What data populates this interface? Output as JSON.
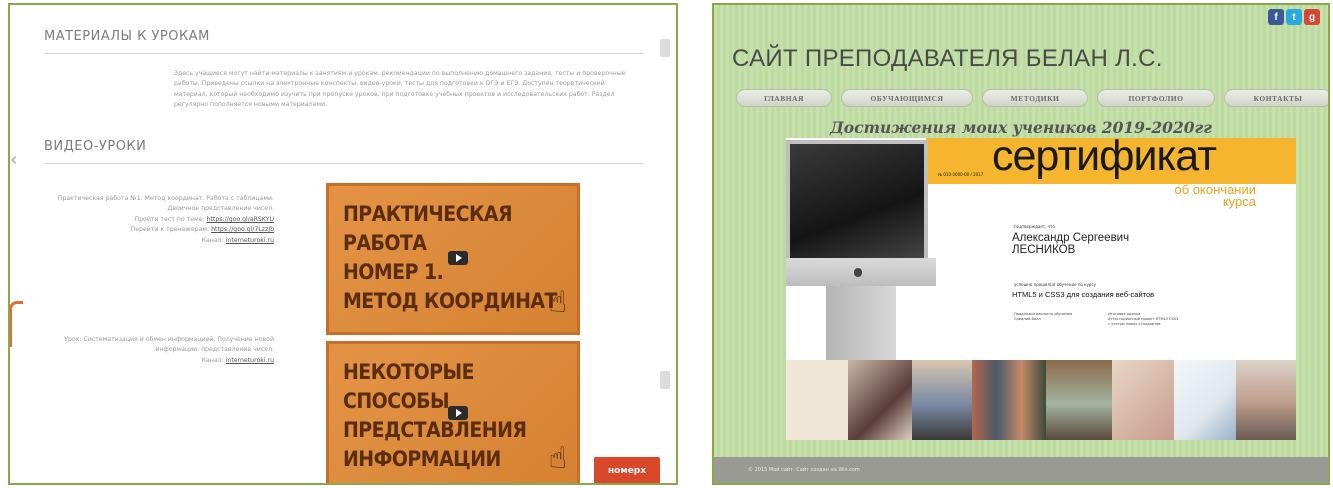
{
  "left": {
    "materials_title": "МАТЕРИАЛЫ К УРОКАМ",
    "materials_text": "Здесь учащиеся могут найти материалы к занятиям и урокам, рекомендации по выполнению домашнего задания, тесты и проверочные работы. Приведены ссылки на электронные конспекты, видео-уроки, тесты для подготовки к ОГЭ и ЕГЭ. Доступен теоретический материал, который необходимо изучить при пропуске уроков, при подготовке учебных проектов и исследовательских работ. Раздел регулярно пополняется новыми материалами.",
    "video_title": "ВИДЕО-УРОКИ",
    "videos": [
      {
        "desc": "Практическая работа №1. Метод координат. Работа с таблицами. Двоичное представление чисел.",
        "link1_label": "Пройти тест по теме:",
        "link1": "https://goo.gl/aRSKYU",
        "link2_label": "Перейти к тренажерам:",
        "link2": "https://goo.gl/7LzzJb",
        "link3_label": "Канал:",
        "link3": "interneturoki.ru",
        "title": "ПРАКТИЧЕСКАЯ РАБОТА\nНОМЕР 1.\nМЕТОД КООРДИНАТ"
      },
      {
        "desc": "Урок: Систематизация и обмен информацией. Получение новой информации, представление чисел.",
        "link3_label": "Канал:",
        "link3": "interneturoki.ru",
        "title": "НЕКОТОРЫЕ СПОСОБЫ\nПРЕДСТАВЛЕНИЯ\nИНФОРМАЦИИ"
      }
    ],
    "hand_glyph": "☝",
    "button_label": "номерх",
    "colors": {
      "video_bg": "#e28a35",
      "button": "#d9482a",
      "frame": "#8aa84a"
    }
  },
  "right": {
    "social": [
      {
        "icon": "facebook-icon",
        "glyph": "f",
        "color": "#3b5998"
      },
      {
        "icon": "twitter-icon",
        "glyph": "t",
        "color": "#2aa9e0"
      },
      {
        "icon": "googleplus-icon",
        "glyph": "g",
        "color": "#d34836"
      }
    ],
    "site_title": "САЙТ ПРЕПОДАВАТЕЛЯ БЕЛАН Л.С.",
    "nav": [
      "ГЛАВНАЯ",
      "ОБУЧАЮЩИМСЯ",
      "МЕТОДИКИ",
      "ПОРТФОЛИО",
      "КОНТАКТЫ"
    ],
    "achievements_title": "Достижения моих учеников 2019-2020гг",
    "certificate": {
      "word": "сертификат",
      "subtitle": "об окончании\nкурса",
      "date": "№ 010-0000-00 / 2017",
      "certify_label": "подтверждает, что",
      "name": "Александр Сергеевич\nЛЕСНИКОВ",
      "passed_label": "успешно прошел(а) обучение по курсу",
      "course": "HTML5 и CSS3 для создания веб-сайтов",
      "fine_left": "Продолжительность обучения\nСредний балл",
      "fine_right": "Итоговая оценка\nАттестационный проект HTML5 CSS3\nс учетом новых стандартов"
    },
    "thumbs": [
      "#f0e6d6",
      "#c9b7a8",
      "#7b8aa5",
      "#b5674a",
      "#8b6a4c",
      "#e9d7c7",
      "#dfe7ee",
      "#c1a290"
    ],
    "footer_text": "© 2015 Мой сайт. Сайт создан на Wix.com",
    "colors": {
      "bg": "#c6e0ab",
      "cert_yellow": "#f5b52e",
      "footer": "#9a9a95"
    }
  }
}
